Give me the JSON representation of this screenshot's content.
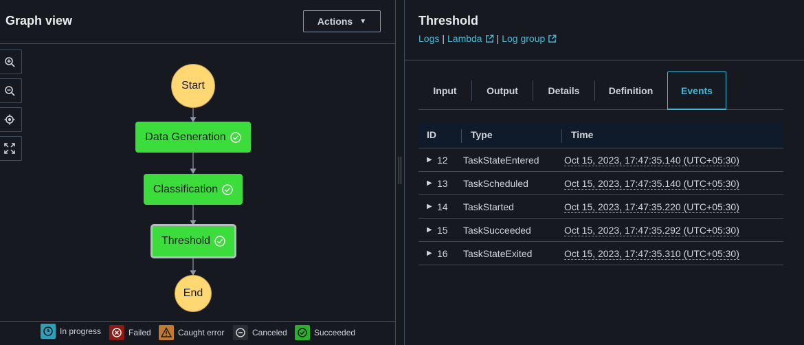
{
  "graph": {
    "title": "Graph view",
    "actions_label": "Actions",
    "nodes": {
      "start": "Start",
      "data_generation": "Data Generation",
      "classification": "Classification",
      "threshold": "Threshold",
      "end": "End"
    },
    "zoom_tools": [
      "zoom-in-icon",
      "zoom-out-icon",
      "center-icon",
      "fit-icon"
    ],
    "legend": [
      {
        "label": "In progress",
        "color": "#2ea0b9",
        "icon": "clock-icon"
      },
      {
        "label": "Failed",
        "color": "#d13212",
        "icon": "x-icon"
      },
      {
        "label": "Caught error",
        "color": "#f89256",
        "icon": "warning-icon"
      },
      {
        "label": "Canceled",
        "color": "#414d5c",
        "icon": "minus-icon"
      },
      {
        "label": "Succeeded",
        "color": "#3ddc3d",
        "icon": "check-icon"
      }
    ]
  },
  "details": {
    "title": "Threshold",
    "links": {
      "logs": "Logs",
      "sep1": "|",
      "lambda": "Lambda",
      "sep2": "|",
      "log_group": "Log group"
    },
    "tabs": [
      "Input",
      "Output",
      "Details",
      "Definition",
      "Events"
    ],
    "active_tab": "Events",
    "table": {
      "headers": {
        "id": "ID",
        "type": "Type",
        "time": "Time"
      },
      "rows": [
        {
          "id": "12",
          "type": "TaskStateEntered",
          "time": "Oct 15, 2023, 17:47:35.140 (UTC+05:30)"
        },
        {
          "id": "13",
          "type": "TaskScheduled",
          "time": "Oct 15, 2023, 17:47:35.140 (UTC+05:30)"
        },
        {
          "id": "14",
          "type": "TaskStarted",
          "time": "Oct 15, 2023, 17:47:35.220 (UTC+05:30)"
        },
        {
          "id": "15",
          "type": "TaskSucceeded",
          "time": "Oct 15, 2023, 17:47:35.292 (UTC+05:30)"
        },
        {
          "id": "16",
          "type": "TaskStateExited",
          "time": "Oct 15, 2023, 17:47:35.310 (UTC+05:30)"
        }
      ]
    }
  },
  "colors": {
    "background": "#16191f",
    "accent": "#44b9d6",
    "success": "#3ddc3d",
    "start_end": "#ffd873"
  }
}
